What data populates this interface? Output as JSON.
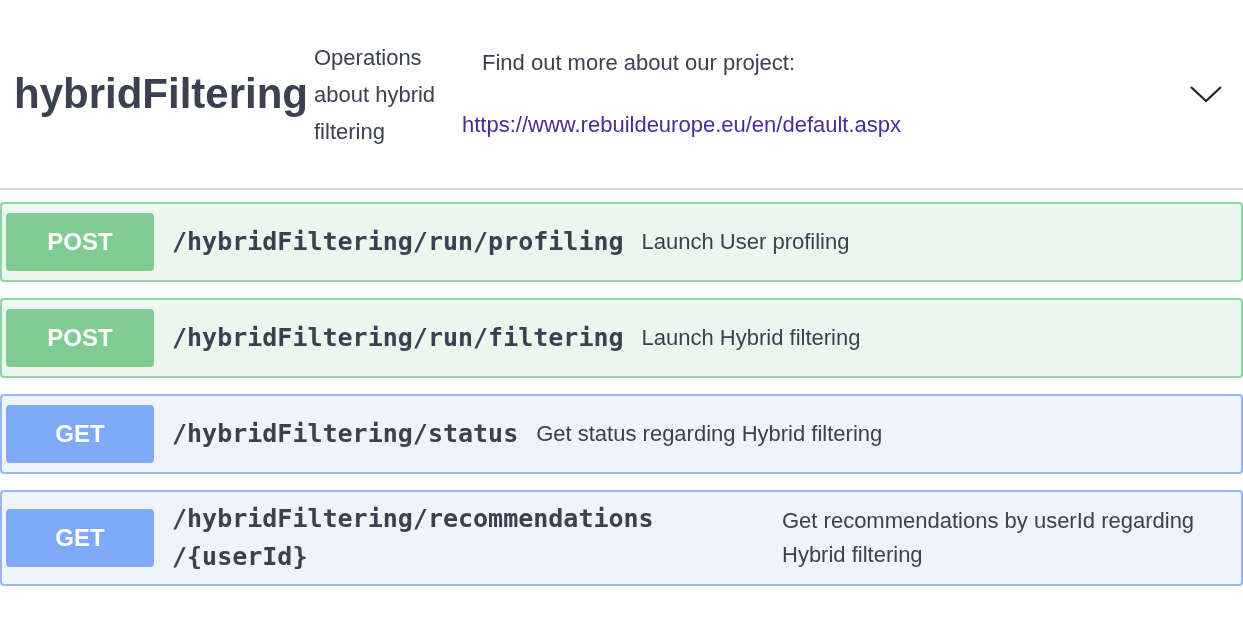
{
  "tag": {
    "name": "hybridFiltering",
    "description": "Operations about hybrid filtering",
    "external_docs": {
      "label": "Find out more about our project:",
      "url": "https://www.rebuildeurope.eu/en/default.aspx"
    },
    "expanded": true
  },
  "operations": [
    {
      "method": "POST",
      "path": "/hybridFiltering/run/profiling",
      "summary": "Launch User profiling"
    },
    {
      "method": "POST",
      "path": "/hybridFiltering/run/filtering",
      "summary": "Launch Hybrid filtering"
    },
    {
      "method": "GET",
      "path": "/hybridFiltering/status",
      "summary": "Get status regarding Hybrid filtering"
    },
    {
      "method": "GET",
      "path": "/hybridFiltering/recommendations/{userId}",
      "summary": "Get recommendations by userId regarding Hybrid filtering"
    }
  ]
}
